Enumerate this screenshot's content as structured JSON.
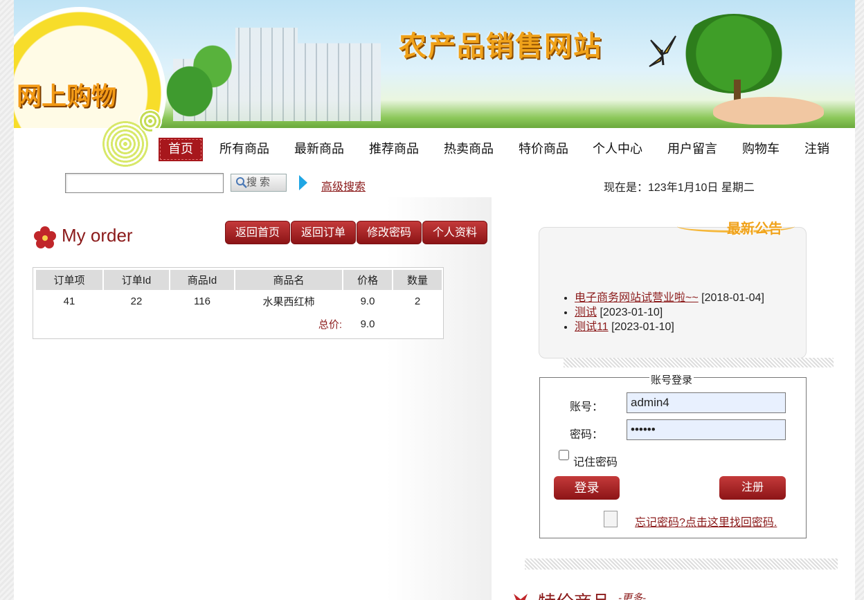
{
  "banner": {
    "site_title": "农产品销售网站",
    "shop_title": "网上购物"
  },
  "nav": {
    "items": [
      "首页",
      "所有商品",
      "最新商品",
      "推荐商品",
      "热卖商品",
      "特价商品",
      "个人中心",
      "用户留言",
      "购物车",
      "注销"
    ],
    "active": "首页"
  },
  "search": {
    "input_value": "",
    "button_label": "搜索",
    "advanced_label": "高级搜索"
  },
  "clock": {
    "text": "现在是：123年1月10日 星期二"
  },
  "order": {
    "title": "My order",
    "buttons": [
      "返回首页",
      "返回订单",
      "修改密码",
      "个人资料"
    ],
    "columns": [
      "订单项",
      "订单Id",
      "商品Id",
      "商品名",
      "价格",
      "数量"
    ],
    "rows": [
      [
        "41",
        "22",
        "116",
        "水果西红柿",
        "9.0",
        "2"
      ]
    ],
    "total_label": "总价:",
    "total_value": "9.0"
  },
  "notice": {
    "title": "最新公告",
    "items": [
      {
        "title": "电子商务网站试营业啦~~",
        "date": "[2018-01-04]"
      },
      {
        "title": "测试",
        "date": "[2023-01-10]"
      },
      {
        "title": "测试11",
        "date": "[2023-01-10]"
      }
    ]
  },
  "login": {
    "legend": "账号登录",
    "account_label": "账号：",
    "account_value": "admin4",
    "password_label": "密码：",
    "password_value": "••••••",
    "remember_label": "记住密码",
    "login_label": "登录",
    "register_label": "注册",
    "forgot_label": "忘记密码?点击这里找回密码."
  },
  "special": {
    "title": "特价商品",
    "more": "-更多-"
  },
  "colors": {
    "brand_red": "#a7171c",
    "accent_orange": "#f0a21a",
    "link_dark_red": "#8b1a1a"
  }
}
